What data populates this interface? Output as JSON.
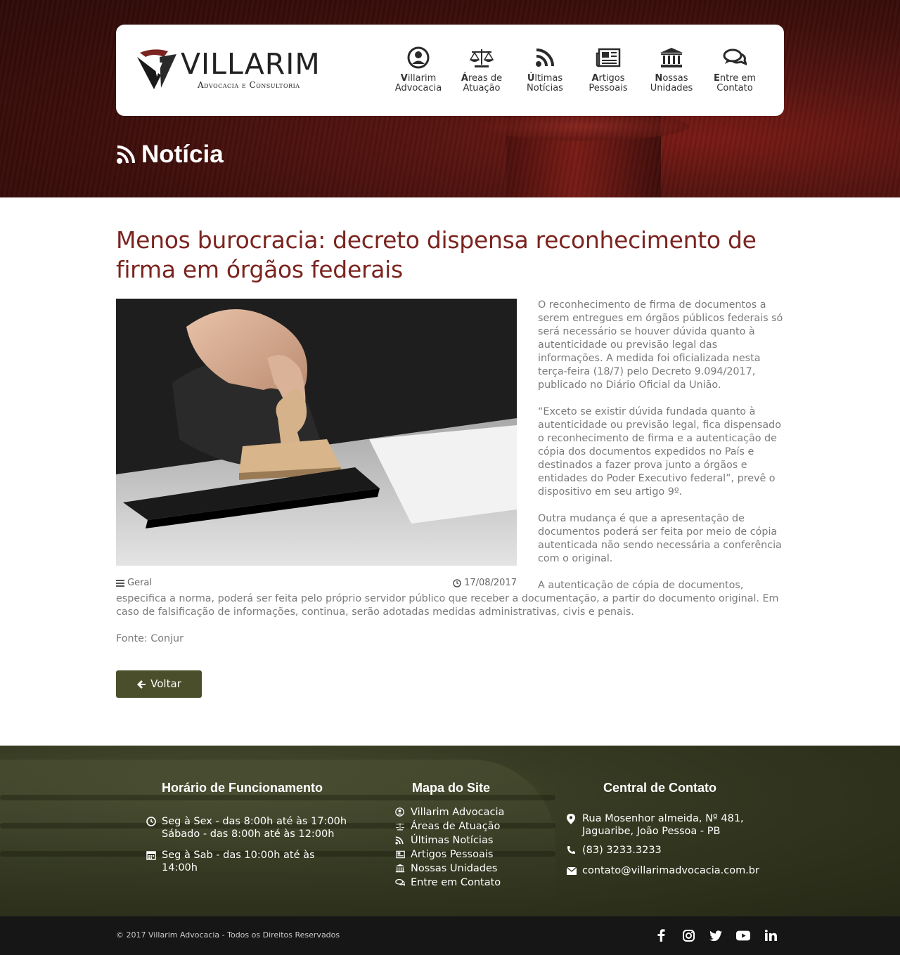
{
  "brand": {
    "name": "Villarim",
    "tagline": "Advocacia e Consultoria"
  },
  "nav": [
    {
      "bold": "V",
      "rest": "illarim",
      "line2": "Advocacia",
      "icon": "user-circle-icon"
    },
    {
      "bold": "Á",
      "rest": "reas de",
      "line2": "Atuação",
      "icon": "scales-icon"
    },
    {
      "bold": "Ú",
      "rest": "ltimas",
      "line2": "Notícias",
      "icon": "rss-icon"
    },
    {
      "bold": "A",
      "rest": "rtigos",
      "line2": "Pessoais",
      "icon": "newspaper-icon"
    },
    {
      "bold": "N",
      "rest": "ossas",
      "line2": "Unidades",
      "icon": "bank-icon"
    },
    {
      "bold": "E",
      "rest": "ntre em",
      "line2": "Contato",
      "icon": "chat-icon"
    }
  ],
  "page_heading": "Notícia",
  "article": {
    "title": "Menos burocracia: decreto dispensa reconhecimento de firma em órgãos federais",
    "category": "Geral",
    "date": "17/08/2017",
    "paragraphs": [
      "O reconhecimento de firma de documentos a serem entregues em órgãos públicos federais só será necessário se houver dúvida quanto à autenticidade ou previsão legal das informações. A medida foi oficializada nesta terça-feira (18/7) pelo Decreto 9.094/2017, publicado no Diário Oficial da União.",
      "“Exceto se existir dúvida fundada quanto à autenticidade ou previsão legal, fica dispensado o reconhecimento de firma e a autenticação de cópia dos documentos expedidos no País e destinados a fazer prova junto a órgãos e entidades do Poder Executivo federal”, prevê o dispositivo em seu artigo 9º.",
      "Outra mudança é que a apresentação de documentos poderá ser feita por meio de cópia autenticada não sendo necessária a conferência com o original.",
      "A autenticação de cópia de documentos, especifica a norma, poderá ser feita pelo próprio servidor público que receber a documentação, a partir do documento original. Em caso de falsificação de informações, continua, serão adotadas medidas administrativas, civis e penais.",
      "Fonte: Conjur"
    ],
    "back_label": "Voltar"
  },
  "footer": {
    "hours": {
      "title": "Horário de Funcionamento",
      "line1": "Seg à Sex - das 8:00h até às 17:00h",
      "line2": "Sábado - das 8:00h até às 12:00h",
      "line3": "Seg à Sab - das 10:00h até às 14:00h"
    },
    "sitemap": {
      "title": "Mapa do Site",
      "items": [
        "Villarim Advocacia",
        "Áreas de Atuação",
        "Últimas Notícias",
        "Artigos Pessoais",
        "Nossas Unidades",
        "Entre em Contato"
      ]
    },
    "contact": {
      "title": "Central de Contato",
      "address": "Rua Mosenhor almeida, Nº 481, Jaguaribe, João Pessoa - PB",
      "phone": "(83) 3233.3233",
      "email": "contato@villarimadvocacia.com.br"
    },
    "copyright": "© 2017 Villarim Advocacia - Todos os Direitos Reservados",
    "social": [
      "facebook-icon",
      "instagram-icon",
      "twitter-icon",
      "youtube-icon",
      "linkedin-icon"
    ]
  },
  "colors": {
    "title": "#7b2420",
    "button": "#4b4e2a",
    "hero": "#3c0e0b",
    "footer": "#363a22"
  }
}
